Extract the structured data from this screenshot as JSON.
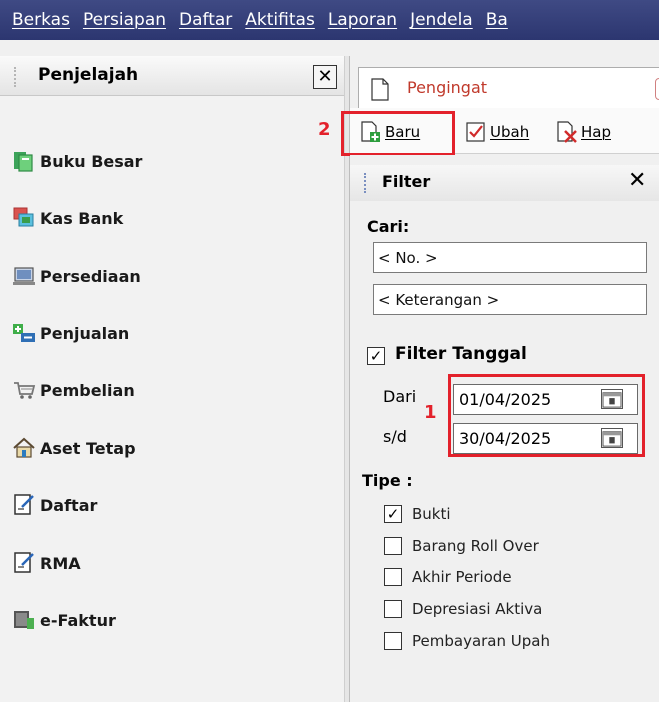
{
  "menubar": {
    "items": [
      "Berkas",
      "Persiapan",
      "Daftar",
      "Aktifitas",
      "Laporan",
      "Jendela",
      "Ba"
    ]
  },
  "explorer": {
    "title": "Penjelajah",
    "close_glyph": "✕",
    "items": [
      {
        "label": "Buku Besar",
        "icon": "ledger-icon"
      },
      {
        "label": "Kas Bank",
        "icon": "cash-bank-icon"
      },
      {
        "label": "Persediaan",
        "icon": "inventory-icon"
      },
      {
        "label": "Penjualan",
        "icon": "sales-icon"
      },
      {
        "label": "Pembelian",
        "icon": "purchase-cart-icon"
      },
      {
        "label": "Aset Tetap",
        "icon": "house-icon"
      },
      {
        "label": "Daftar",
        "icon": "list-icon"
      },
      {
        "label": "RMA",
        "icon": "rma-icon"
      },
      {
        "label": "e-Faktur",
        "icon": "efaktur-icon"
      }
    ]
  },
  "tab": {
    "label": "Pengingat"
  },
  "toolbar": {
    "new_label": "Baru",
    "edit_label": "Ubah",
    "delete_label": "Hap"
  },
  "callouts": {
    "one": "1",
    "two": "2"
  },
  "filter": {
    "title": "Filter",
    "close_glyph": "✕",
    "search_label": "Cari:",
    "no_placeholder": "< No. >",
    "desc_placeholder": "< Keterangan >",
    "date_filter_label": "Filter Tanggal",
    "date_filter_checked": true,
    "from_label": "Dari",
    "to_label": "s/d",
    "from_date": "01/04/2025",
    "to_date": "30/04/2025",
    "type_label": "Tipe :",
    "types": [
      {
        "label": "Bukti",
        "checked": true
      },
      {
        "label": "Barang Roll Over",
        "checked": false
      },
      {
        "label": "Akhir Periode",
        "checked": false
      },
      {
        "label": "Depresiasi Aktiva",
        "checked": false
      },
      {
        "label": "Pembayaran Upah",
        "checked": false
      }
    ],
    "check_glyph": "✓"
  },
  "colors": {
    "menubar": "#3f4a84",
    "callout": "#e3212b",
    "tab_text": "#c0392b"
  }
}
